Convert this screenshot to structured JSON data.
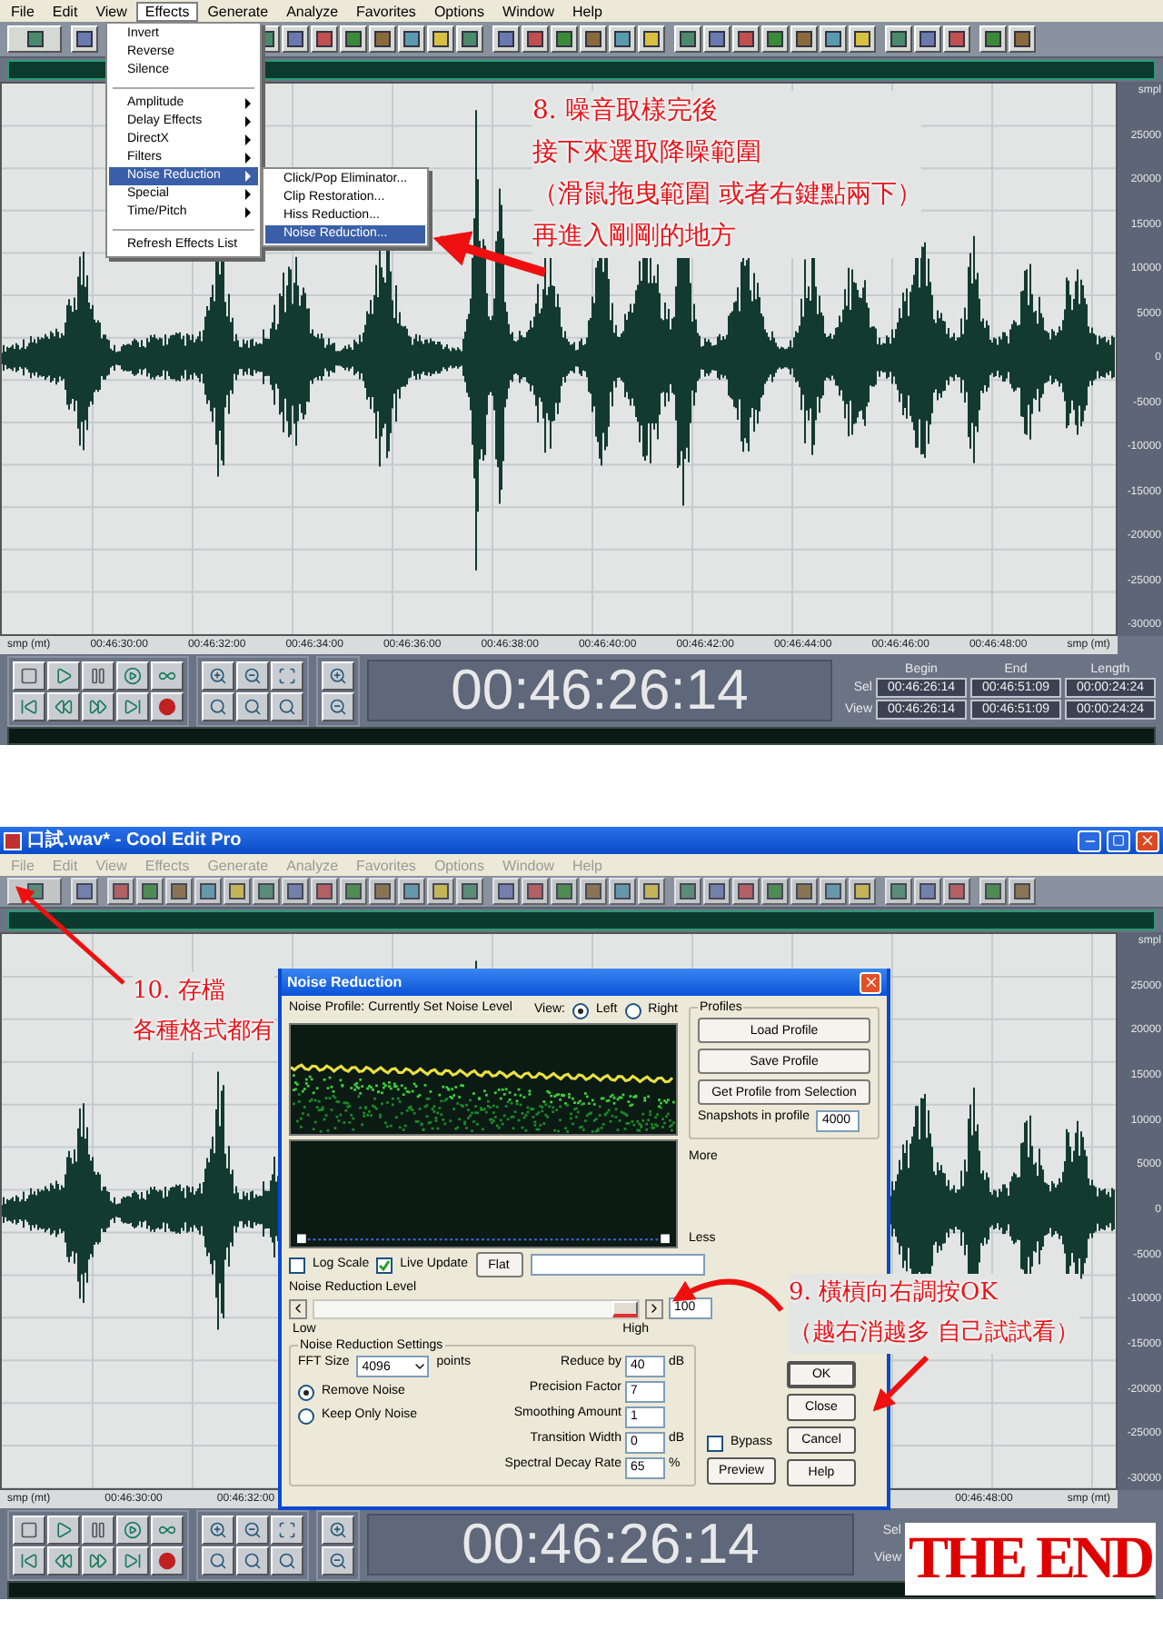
{
  "top": {
    "menu": [
      {
        "label": "File",
        "selected": false,
        "disabled": false
      },
      {
        "label": "Edit",
        "selected": false,
        "disabled": false
      },
      {
        "label": "View",
        "selected": false,
        "disabled": false
      },
      {
        "label": "Effects",
        "selected": true,
        "disabled": false
      },
      {
        "label": "Generate",
        "selected": false,
        "disabled": false
      },
      {
        "label": "Analyze",
        "selected": false,
        "disabled": false
      },
      {
        "label": "Favorites",
        "selected": false,
        "disabled": false
      },
      {
        "label": "Options",
        "selected": false,
        "disabled": false
      },
      {
        "label": "Window",
        "selected": false,
        "disabled": false
      },
      {
        "label": "Help",
        "selected": false,
        "disabled": false
      }
    ],
    "effects_menu": [
      {
        "kind": "item",
        "label": "Invert",
        "selected": false
      },
      {
        "kind": "item",
        "label": "Reverse",
        "selected": false
      },
      {
        "kind": "item",
        "label": "Silence",
        "selected": false
      },
      {
        "kind": "separator"
      },
      {
        "kind": "submenu",
        "label": "Amplitude",
        "selected": false
      },
      {
        "kind": "submenu",
        "label": "Delay Effects",
        "selected": false
      },
      {
        "kind": "submenu",
        "label": "DirectX",
        "selected": false
      },
      {
        "kind": "submenu",
        "label": "Filters",
        "selected": false
      },
      {
        "kind": "submenu",
        "label": "Noise Reduction",
        "selected": true
      },
      {
        "kind": "submenu",
        "label": "Special",
        "selected": false
      },
      {
        "kind": "submenu",
        "label": "Time/Pitch",
        "selected": false
      },
      {
        "kind": "separator"
      },
      {
        "kind": "item",
        "label": "Refresh Effects List",
        "selected": false
      }
    ],
    "submenu": [
      {
        "label": "Click/Pop Eliminator...",
        "selected": false
      },
      {
        "label": "Clip Restoration...",
        "selected": false
      },
      {
        "label": "Hiss Reduction...",
        "selected": false
      },
      {
        "label": "Noise Reduction...",
        "selected": true
      }
    ],
    "annotation": [
      "8.  噪音取樣完後",
      "接下來選取降噪範圍",
      "（滑鼠拖曳範圍 或者右鍵點兩下）",
      "再進入剛剛的地方"
    ],
    "y_axis": [
      "smpl",
      "25000",
      "20000",
      "15000",
      "10000",
      "5000",
      "0",
      "-5000",
      "-10000",
      "-15000",
      "-20000",
      "-25000",
      "-30000"
    ],
    "ruler": [
      "smp (mt)",
      "00:46:30:00",
      "00:46:32:00",
      "00:46:34:00",
      "00:46:36:00",
      "00:46:38:00",
      "00:46:40:00",
      "00:46:42:00",
      "00:46:44:00",
      "00:46:46:00",
      "00:46:48:00",
      "smp (mt)"
    ],
    "transport": {
      "time": "00:46:26:14",
      "columns": [
        "Begin",
        "End",
        "Length"
      ],
      "rows": [
        {
          "label": "Sel",
          "values": [
            "00:46:26:14",
            "00:46:51:09",
            "00:00:24:24"
          ]
        },
        {
          "label": "View",
          "values": [
            "00:46:26:14",
            "00:46:51:09",
            "00:00:24:24"
          ]
        }
      ]
    }
  },
  "bottom": {
    "window": {
      "title": "口試.wav* - Cool Edit Pro"
    },
    "menu": [
      {
        "label": "File",
        "selected": false,
        "disabled": true
      },
      {
        "label": "Edit",
        "selected": false,
        "disabled": true
      },
      {
        "label": "View",
        "selected": false,
        "disabled": true
      },
      {
        "label": "Effects",
        "selected": false,
        "disabled": true
      },
      {
        "label": "Generate",
        "selected": false,
        "disabled": true
      },
      {
        "label": "Analyze",
        "selected": false,
        "disabled": true
      },
      {
        "label": "Favorites",
        "selected": false,
        "disabled": true
      },
      {
        "label": "Options",
        "selected": false,
        "disabled": true
      },
      {
        "label": "Window",
        "selected": false,
        "disabled": true
      },
      {
        "label": "Help",
        "selected": false,
        "disabled": true
      }
    ],
    "annotation_save": [
      "10. 存檔",
      "各種格式都有"
    ],
    "annotation_level": [
      "9. 橫槓向右調按OK",
      "（越右消越多 自己試試看）"
    ],
    "y_axis": [
      "smpl",
      "25000",
      "20000",
      "15000",
      "10000",
      "5000",
      "0",
      "-5000",
      "-10000",
      "-15000",
      "-20000",
      "-25000",
      "-30000"
    ],
    "ruler_left": [
      "smp (mt)",
      "00:46:30:00",
      "00:46:32:00"
    ],
    "ruler_right": [
      "00:46:48:00",
      "smp (mt)"
    ],
    "transport": {
      "time": "00:46:26:14",
      "row_labels": [
        "Sel",
        "View"
      ]
    },
    "overlay": "THE END",
    "dialog": {
      "title": "Noise Reduction",
      "profile_label": "Noise Profile: Currently Set Noise Level",
      "view_label": "View:",
      "view_options": [
        {
          "label": "Left",
          "selected": true
        },
        {
          "label": "Right",
          "selected": false
        }
      ],
      "profiles": {
        "title": "Profiles",
        "buttons": [
          "Load Profile",
          "Save Profile",
          "Get Profile from Selection"
        ],
        "snapshots_label": "Snapshots in profile",
        "snapshots": "4000"
      },
      "graph_top": "More",
      "graph_bottom": "Less",
      "checkboxes": [
        {
          "label": "Log Scale",
          "checked": false
        },
        {
          "label": "Live Update",
          "checked": true
        }
      ],
      "flat_button": "Flat",
      "level_label": "Noise Reduction Level",
      "level_slider": {
        "level": 1.0
      },
      "level_value": "100",
      "low": "Low",
      "high": "High",
      "settings": {
        "title": "Noise Reduction Settings",
        "fft_label": "FFT Size",
        "fft_value": "4096",
        "fft_unit": "points",
        "modes": [
          {
            "label": "Remove Noise",
            "selected": true
          },
          {
            "label": "Keep Only Noise",
            "selected": false
          }
        ],
        "fields": [
          {
            "label": "Reduce by",
            "value": "40",
            "unit": "dB"
          },
          {
            "label": "Precision Factor",
            "value": "7"
          },
          {
            "label": "Smoothing Amount",
            "value": "1"
          },
          {
            "label": "Transition Width",
            "value": "0",
            "unit": "dB"
          },
          {
            "label": "Spectral Decay Rate",
            "value": "65",
            "unit": "%"
          }
        ]
      },
      "bypass": {
        "label": "Bypass",
        "checked": false
      },
      "preview": "Preview",
      "buttons": [
        "OK",
        "Close",
        "Cancel",
        "Help"
      ]
    }
  }
}
